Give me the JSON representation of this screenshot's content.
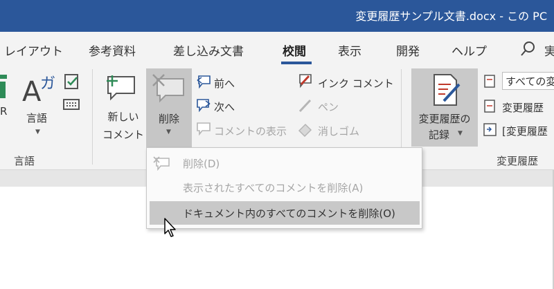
{
  "window": {
    "title": "変更履歴サンプル文書.docx - この PC"
  },
  "tabs": [
    {
      "label": "レイアウト",
      "active": false
    },
    {
      "label": "参考資料",
      "active": false
    },
    {
      "label": "差し込み文書",
      "active": false
    },
    {
      "label": "校閲",
      "active": true
    },
    {
      "label": "表示",
      "active": false
    },
    {
      "label": "開発",
      "active": false
    },
    {
      "label": "ヘルプ",
      "active": false
    }
  ],
  "tab_cutoff": "実",
  "ribbon": {
    "language_group": {
      "partial_left": "R",
      "language_button": "言語",
      "group_label": "言語"
    },
    "comments_group": {
      "new_comment_line1": "新しい",
      "new_comment_line2": "コメント",
      "delete_button": "削除",
      "prev": "前へ",
      "next": "次へ",
      "show_comments": "コメントの表示"
    },
    "ink_group": {
      "ink_comment": "インク コメント",
      "pen": "ペン",
      "eraser": "消しゴム"
    },
    "tracking_group": {
      "track_changes_line1": "変更履歴の",
      "track_changes_line2": "記録",
      "markup_select": "すべての変",
      "row2": "変更履歴",
      "row3": "[変更履歴",
      "group_label": "変更履歴"
    }
  },
  "delete_menu": {
    "items": [
      {
        "label": "削除(D)",
        "enabled": false,
        "hover": false
      },
      {
        "label": "表示されたすべてのコメントを削除(A)",
        "enabled": false,
        "hover": false
      },
      {
        "label": "ドキュメント内のすべてのコメントを削除(O)",
        "enabled": true,
        "hover": true
      }
    ]
  },
  "colors": {
    "titlebar": "#2b579a",
    "ribbon": "#f3f3f3",
    "pressed": "#c6c6c6",
    "accent_red": "#c0392b",
    "accent_green": "#2e8b57"
  }
}
